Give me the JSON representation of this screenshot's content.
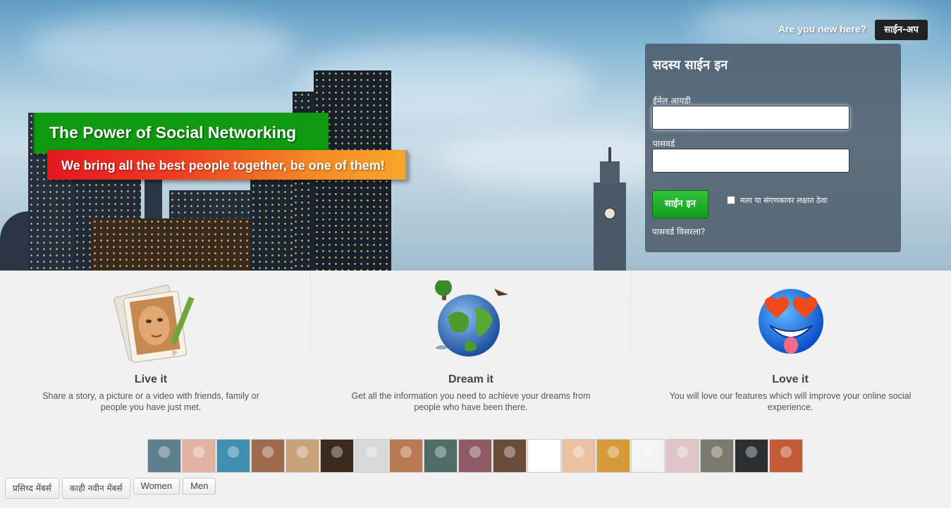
{
  "hero": {
    "headline": "The Power of Social Networking",
    "subheadline": "We bring all the best people together, be one of them!"
  },
  "signup": {
    "prompt": "Are you new here?",
    "button_label": "साईन-अप"
  },
  "login": {
    "title": "सदस्य साईन इन",
    "email_label": "ईमेल आयडी",
    "email_value": "",
    "password_label": "पासवर्ड",
    "password_value": "",
    "submit_label": "साईन इन",
    "remember_label": "मला या संगणकावर लक्षात ठेवा",
    "remember_checked": false,
    "forgot_label": "पासवर्ड विसरला?"
  },
  "features": [
    {
      "icon": "portrait-pencil-icon",
      "title": "Live it",
      "text": "Share a story, a picture or a video with friends, family or people you have just met."
    },
    {
      "icon": "globe-icon",
      "title": "Dream it",
      "text": "Get all the information you need to achieve your dreams from people who have been there."
    },
    {
      "icon": "heart-eyes-smiley-icon",
      "title": "Love it",
      "text": "You will love our features which will improve your online social experience."
    }
  ],
  "member_avatars": [
    {
      "color": "#5e7f8e"
    },
    {
      "color": "#e2b3a2"
    },
    {
      "color": "#3e8fb0"
    },
    {
      "color": "#9e6b4e"
    },
    {
      "color": "#c9a27a"
    },
    {
      "color": "#3b2a1c"
    },
    {
      "color": "#d8d8d8"
    },
    {
      "color": "#b87a52"
    },
    {
      "color": "#4f6d66"
    },
    {
      "color": "#8e5a66"
    },
    {
      "color": "#6b4b3a"
    },
    {
      "color": "#ffffff"
    },
    {
      "color": "#e9c2a4"
    },
    {
      "color": "#d79a3b"
    },
    {
      "color": "#f3f3f3"
    },
    {
      "color": "#dfc5c8"
    },
    {
      "color": "#7b7a6f"
    },
    {
      "color": "#2d2f33"
    },
    {
      "color": "#c15b3a"
    }
  ],
  "member_tabs": [
    "प्रसिध्द मेंबर्स",
    "काही नवीन मेंबर्स",
    "Women",
    "Men"
  ]
}
